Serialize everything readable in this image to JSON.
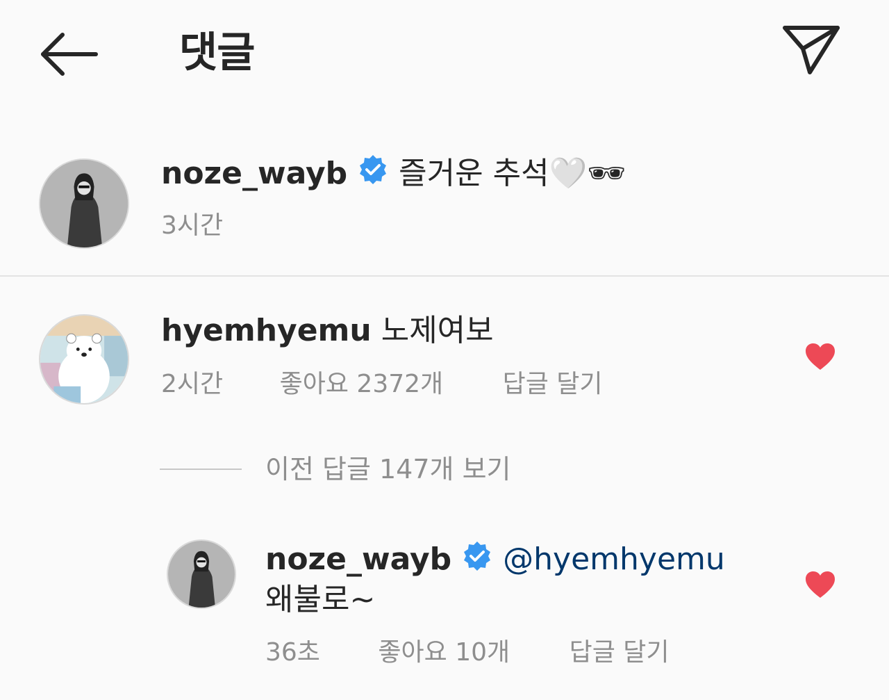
{
  "header": {
    "title": "댓글"
  },
  "caption": {
    "username": "noze_wayb",
    "text": "즐거운 추석🤍🕶",
    "time": "3시간"
  },
  "comments": [
    {
      "username": "hyemhyemu",
      "text": "노제여보",
      "time": "2시간",
      "likes": "좋아요 2372개",
      "reply_label": "답글 달기",
      "liked": true,
      "view_replies": "이전 답글 147개 보기",
      "replies": [
        {
          "username": "noze_wayb",
          "mention": "@hyemhyemu",
          "text": "왜불로~",
          "time": "36초",
          "likes": "좋아요 10개",
          "reply_label": "답글 달기",
          "liked": true
        }
      ]
    }
  ],
  "colors": {
    "background": "#fafafa",
    "verified": "#3897f0",
    "heart": "#ed4956",
    "secondary_text": "#8e8e8e",
    "mention": "#00376b"
  }
}
